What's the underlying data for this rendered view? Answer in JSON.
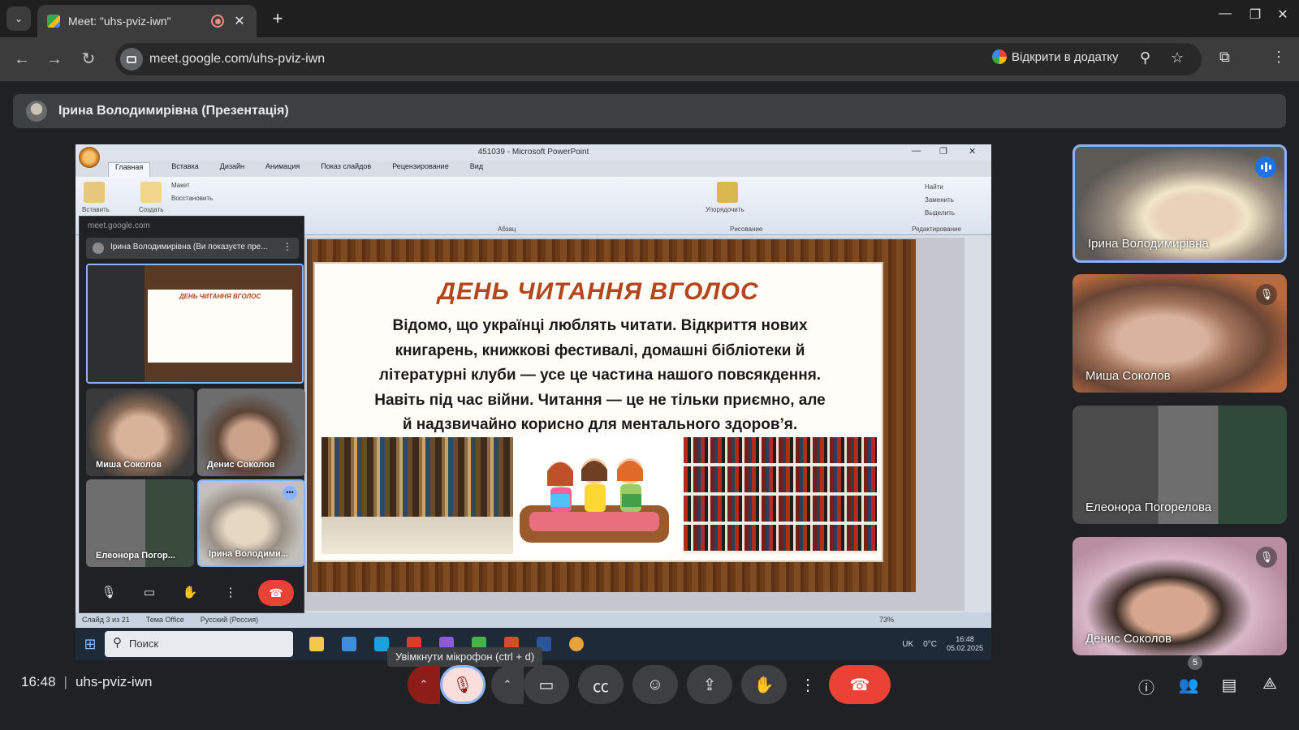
{
  "browser": {
    "tab_title": "Meet: \"uhs-pviz-iwn\"",
    "url": "meet.google.com/uhs-pviz-iwn",
    "open_in_app_label": "Відкрити в додатку",
    "tab_list_glyph": "⌄",
    "new_tab_glyph": "+",
    "close_glyph": "✕",
    "minimize_glyph": "—",
    "restore_glyph": "❐",
    "back_glyph": "←",
    "forward_glyph": "→",
    "reload_glyph": "↻"
  },
  "presenter_bar": {
    "label": "Ірина Володимирівна (Презентація)"
  },
  "powerpoint": {
    "window_title": "451039 - Microsoft PowerPoint",
    "tabs": [
      "Главная",
      "Вставка",
      "Дизайн",
      "Анимация",
      "Показ слайдов",
      "Рецензирование",
      "Вид"
    ],
    "ribbon": {
      "paste_label": "Вставить",
      "create_label": "Создать",
      "layout_label": "Макет",
      "restore_label": "Восстановить",
      "paragraph_group": "Абзац",
      "arrange_label": "Упорядочить",
      "drawing_group": "Рисование",
      "find_label": "Найти",
      "replace_label": "Заменить",
      "select_label": "Выделить",
      "editing_group": "Редактирование"
    },
    "status": {
      "slide": "Слайд 3 из 21",
      "theme": "Тема Office",
      "language": "Русский (Россия)",
      "zoom": "73%"
    }
  },
  "slide": {
    "title": "ДЕНЬ ЧИТАННЯ ВГОЛОС",
    "lines": [
      "Відомо, що українці люблять читати. Відкриття нових",
      "книгарень, книжкові фестивалі, домашні бібліотеки й",
      "літературні клуби — усе це частина нашого повсякдення.",
      "Навіть під час війни. Читання — це не тільки приємно, але",
      "й надзвичайно корисно для ментального здоров’я."
    ]
  },
  "mini_meet": {
    "host": "meet.google.com",
    "presenting_label": "Ірина Володимирівна (Ви показуєте пре...",
    "preview_title": "ДЕНЬ ЧИТАННЯ ВГОЛОС",
    "tiles": [
      "Миша Соколов",
      "Денис Соколов",
      "Елеонора Погор...",
      "Ірина Володими..."
    ]
  },
  "windows_taskbar": {
    "search_placeholder": "Поиск",
    "weather": "0°C",
    "keyboard": "UK",
    "time": "16:48",
    "date": "05.02.2025"
  },
  "participants": [
    {
      "name": "Ірина Володимирівна",
      "speaking": true,
      "muted": false
    },
    {
      "name": "Миша Соколов",
      "speaking": false,
      "muted": true
    },
    {
      "name": "Елеонора Погорелова",
      "speaking": false,
      "muted": false
    },
    {
      "name": "Денис Соколов",
      "speaking": false,
      "muted": true
    }
  ],
  "meeting": {
    "time": "16:48",
    "separator": "|",
    "code": "uhs-pviz-iwn",
    "mic_tooltip": "Увімкнути мікрофон (ctrl + d)",
    "people_count": "5"
  },
  "colors": {
    "end_call": "#ea4335",
    "mic_off_bg": "#f9dedc",
    "accent": "#8ab4f8",
    "meet_bg": "#202124"
  }
}
